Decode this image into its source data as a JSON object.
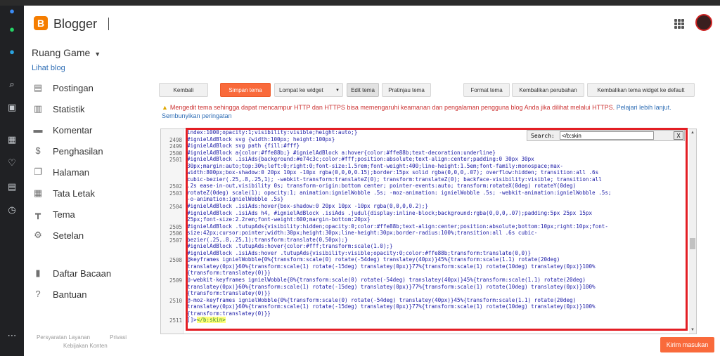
{
  "app": {
    "logo_letter": "B",
    "name": "Blogger",
    "brand_color": "#f57d00",
    "accent_color": "#f96a3b",
    "warning_color": "#cc3333"
  },
  "rail": {
    "icons": [
      "messenger-icon",
      "whatsapp-icon",
      "telegram-icon",
      "search-icon",
      "wallet-icon",
      "apps-grid-icon",
      "heart-icon",
      "news-icon",
      "clock-icon",
      "more-icon"
    ]
  },
  "sidebar": {
    "blog_name": "Ruang Game",
    "view_blog": "Lihat blog",
    "items": [
      {
        "icon": "posts-icon",
        "label": "Postingan"
      },
      {
        "icon": "stats-icon",
        "label": "Statistik"
      },
      {
        "icon": "comments-icon",
        "label": "Komentar"
      },
      {
        "icon": "earnings-icon",
        "label": "Penghasilan"
      },
      {
        "icon": "pages-icon",
        "label": "Halaman"
      },
      {
        "icon": "layout-icon",
        "label": "Tata Letak"
      },
      {
        "icon": "theme-icon",
        "label": "Tema"
      },
      {
        "icon": "settings-icon",
        "label": "Setelan"
      }
    ],
    "secondary": [
      {
        "icon": "reading-list-icon",
        "label": "Daftar Bacaan"
      },
      {
        "icon": "help-icon",
        "label": "Bantuan"
      }
    ],
    "footer": {
      "terms": "Persyaratan Layanan",
      "privacy": "Privasi",
      "content_policy": "Kebijakan Konten"
    }
  },
  "toolbar": {
    "back": "Kembali",
    "save_theme": "Simpan tema",
    "jump_widget": "Lompat ke widget",
    "edit_theme": "Edit tema",
    "preview_theme": "Pratinjau tema",
    "format_theme": "Format tema",
    "revert_changes": "Kembalikan perubahan",
    "revert_widgets": "Kembalikan tema widget ke default"
  },
  "warning": {
    "text": "Mengedit tema sehingga dapat mencampur HTTP dan HTTPS bisa memengaruhi keamanan dan pengalaman pengguna blog Anda jika dilihat melalui HTTPS.",
    "learn_more": "Pelajari lebih lanjut.",
    "hide": "Sembunyikan peringatan"
  },
  "search": {
    "label": "Search:",
    "value": "</b:skin",
    "close": "X"
  },
  "editor": {
    "line_numbers": [
      "2498",
      "2499",
      "2500",
      "2501",
      "2502",
      "2503",
      "2504",
      "2505",
      "2506",
      "2507",
      "2508",
      "2509",
      "2510",
      "2511"
    ],
    "lines": [
      "index:1000;opacity:1;visibility:visible;height:auto;}",
      "#ignielAdBlock svg {width:100px; height:100px}",
      "#ignielAdBlock svg path {fill:#fff}",
      "#ignielAdBlock a{color:#ffe88b;} #ignielAdBlock a:hover{color:#ffe88b;text-decoration:underline}",
      "#ignielAdBlock .isiAds{background:#e74c3c;color:#fff;position:absolute;text-align:center;padding:0 30px 30px",
      "30px;margin:auto;top:30%;left:0;right:0;font-size:1.5rem;font-weight:400;line-height:1.5em;font-family:monospace;max-",
      "width:800px;box-shadow:0 20px 10px -10px rgba(0,0,0,0.15);border:15px solid rgba(0,0,0,.07); overflow:hidden; transition:all .6s",
      "cubic-bezier(.25,.8,.25,1); -webkit-transform:translateZ(0); transform:translateZ(0); backface-visibility:visible; transition:all",
      ".2s ease-in-out,visibility 0s; transform-origin:bottom center; pointer-events:auto; transform:rotateX(0deg) rotateY(0deg)",
      "rotateZ(0deg) scale(1); opacity:1; animation:ignielWobble .5s; -moz-animation: ignielWobble .5s; -webkit-animation:ignielWobble .5s;",
      "-o-animation:ignielWobble .5s}",
      "#ignielAdBlock .isiAds:hover{box-shadow:0 20px 10px -10px rgba(0,0,0,0.2);}",
      "#ignielAdBlock .isiAds h4, #ignielAdBlock .isiAds .judul{display:inline-block;background:rgba(0,0,0,.07);padding:5px 25px 15px",
      "25px;font-size:2.2rem;font-weight:600;margin-bottom:20px}",
      "#ignielAdBlock .tutupAds{visibility:hidden;opacity:0;color:#ffe88b;text-align:center;position:absolute;bottom:10px;right:10px;font-",
      "size:42px;cursor:pointer;width:30px;height:30px;line-height:30px;border-radius:100%;transition:all .6s cubic-",
      "bezier(.25,.8,.25,1);transform:translate(0,50px);}",
      "#ignielAdBlock .tutupAds:hover{color:#fff;transform:scale(1.0);}",
      "#ignielAdBlock .isiAds:hover .tutupAds{visibility:visible;opacity:0;color:#ffe88b;transform:translate(0,0)}",
      "@keyframes ignielWobble{0%{transform:scale(0) rotate(-54deg) translatey(40px)}45%{transform:scale(1.1) rotate(20deg)",
      "translatey(0px)}60%{transform:scale(1) rotate(-15deg) translatey(0px)}77%{transform:scale(1) rotate(10deg) translatey(0px)}100%",
      "{transform:translatey(0)}}",
      "@-webkit-keyframes ignielWobble{0%{transform:scale(0) rotate(-54deg) translatey(40px)}45%{transform:scale(1.1) rotate(20deg)",
      "translatey(0px)}60%{transform:scale(1) rotate(-15deg) translatey(0px)}77%{transform:scale(1) rotate(10deg) translatey(0px)}100%",
      "{transform:translatey(0)}}",
      "@-moz-keyframes ignielWobble{0%{transform:scale(0) rotate(-54deg) translatey(40px)}45%{transform:scale(1.1) rotate(20deg)",
      "translatey(0px)}60%{transform:scale(1) rotate(-15deg) translatey(0px)}77%{transform:scale(1) rotate(10deg) translatey(0px)}100%",
      "{transform:translatey(0)}}"
    ],
    "closing_prefix": "]]>",
    "closing_tag": "</b:skin>"
  },
  "feedback": "Kirim masukan"
}
